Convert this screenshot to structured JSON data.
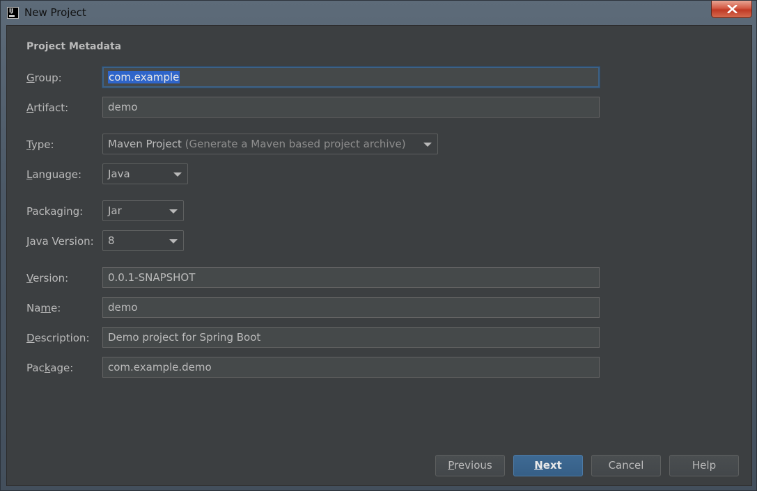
{
  "window": {
    "title": "New Project",
    "close_symbol": "×"
  },
  "section": {
    "title": "Project Metadata"
  },
  "fields": {
    "group": {
      "label_mnemonic": "G",
      "label_rest": "roup:",
      "value": "com.example"
    },
    "artifact": {
      "label_mnemonic": "A",
      "label_rest": "rtifact:",
      "value": "demo"
    },
    "type": {
      "label_mnemonic": "T",
      "label_rest": "ype:",
      "value": "Maven Project",
      "hint": "(Generate a Maven based project archive)"
    },
    "language": {
      "label_mnemonic": "L",
      "label_rest": "anguage:",
      "value": "Java"
    },
    "packaging": {
      "label": "Packaging:",
      "value": "Jar"
    },
    "java_version": {
      "label_mnemonic": "J",
      "label_rest": "ava Version:",
      "value": "8"
    },
    "version": {
      "label_mnemonic": "V",
      "label_rest": "ersion:",
      "value": "0.0.1-SNAPSHOT"
    },
    "name": {
      "label_pre": "Na",
      "label_mnemonic": "m",
      "label_rest": "e:",
      "value": "demo"
    },
    "description": {
      "label_mnemonic": "D",
      "label_rest": "escription:",
      "value": "Demo project for Spring Boot"
    },
    "package": {
      "label_pre": "Pac",
      "label_mnemonic": "k",
      "label_rest": "age:",
      "value": "com.example.demo"
    }
  },
  "buttons": {
    "previous": {
      "mnemonic": "P",
      "rest": "revious"
    },
    "next": {
      "mnemonic": "N",
      "rest": "ext"
    },
    "cancel": "Cancel",
    "help": "Help"
  },
  "colors": {
    "dialog_bg": "#3c3f41",
    "field_bg": "#45494a",
    "text": "#bbbbbb",
    "primary_button": "#365f86",
    "selection": "#2f65ca",
    "close_button": "#c03a25"
  },
  "icons": {
    "app": "intellij-idea-icon",
    "close": "close-icon",
    "dropdown": "chevron-down-icon"
  }
}
